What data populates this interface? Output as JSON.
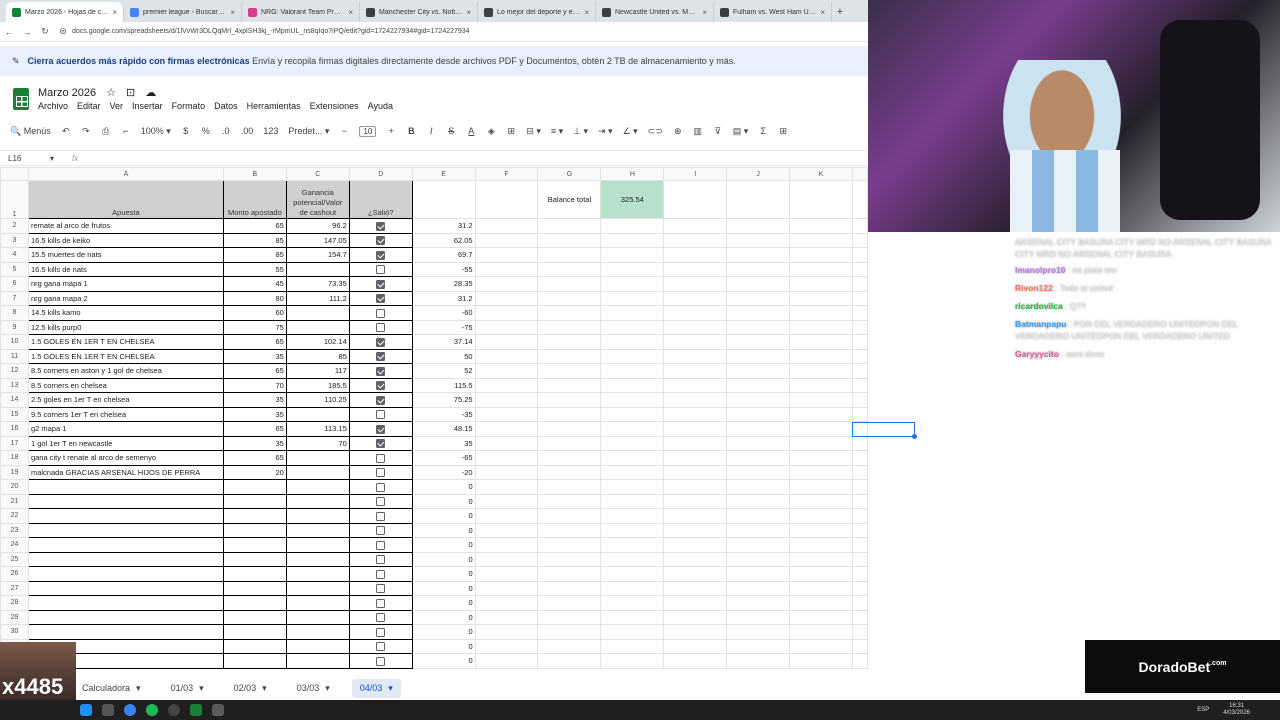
{
  "browser": {
    "tabs": [
      {
        "title": "Marzo 2026 - Hojas de cálculo",
        "color": "#188038",
        "active": true
      },
      {
        "title": "premier league - Buscar con G",
        "color": "#4285f4"
      },
      {
        "title": "NRG: Valorant Team Profile | V",
        "color": "#d93a8b"
      },
      {
        "title": "Manchester City vs. Nottingham",
        "color": "#3c4043"
      },
      {
        "title": "Lo mejor del deporte y el entre",
        "color": "#3c4043"
      },
      {
        "title": "Newcastle United vs. Manchester",
        "color": "#3c4043"
      },
      {
        "title": "Fulham vs. West Ham United | ",
        "color": "#3c4043"
      }
    ],
    "url": "docs.google.com/spreadsheets/d/1lVvWr3DLQqMrl_4xplSH3kj_-rMpmUL_ns8qIqo7iPQ/edit?gid=1724227934#gid=1724227934"
  },
  "banner": {
    "bold": "Cierra acuerdos más rápido con firmas electrónicas",
    "text": "Envía y recopila firmas digitales directamente desde archivos PDF y Documentos, obtén 2 TB de almacenamiento y más."
  },
  "doc": {
    "title": "Marzo 2026"
  },
  "menu": [
    "Archivo",
    "Editar",
    "Ver",
    "Insertar",
    "Formato",
    "Datos",
    "Herramientas",
    "Extensiones",
    "Ayuda"
  ],
  "toolbar": {
    "search": "Menús",
    "zoom": "100%",
    "currency": "$",
    "percent": "%",
    "dec_less": ".0",
    "dec_more": ".00",
    "numfmt": "123",
    "font": "Predet...",
    "fontsize": "10",
    "bold": "B",
    "italic": "I",
    "strike": "S",
    "textcolor": "A"
  },
  "formula": {
    "cellref": "L16",
    "fx": "fx"
  },
  "columns": [
    "A",
    "B",
    "C",
    "D",
    "E",
    "F",
    "G",
    "H",
    "I",
    "J",
    "K"
  ],
  "headers": {
    "a": "Apuesta",
    "b": "Monto apostado",
    "c": "Ganancia potencial/Valor de cashout",
    "d": "¿Salió?",
    "g": "Balance total",
    "h": "325.54"
  },
  "rows": [
    {
      "n": "2",
      "a": "remate al arco de frutos",
      "b": "65",
      "c": "96.2",
      "d": true,
      "e": "31.2"
    },
    {
      "n": "3",
      "a": "16.5 kills de keiko",
      "b": "85",
      "c": "147.05",
      "d": true,
      "e": "62.05"
    },
    {
      "n": "4",
      "a": "15.5 muertes de nats",
      "b": "85",
      "c": "154.7",
      "d": true,
      "e": "69.7"
    },
    {
      "n": "5",
      "a": "16.5 kills de nats",
      "b": "55",
      "c": "",
      "d": false,
      "e": "-55"
    },
    {
      "n": "6",
      "a": "nrg gana mapa 1",
      "b": "45",
      "c": "73.35",
      "d": true,
      "e": "28.35"
    },
    {
      "n": "7",
      "a": "nrg gana mapa 2",
      "b": "80",
      "c": "111.2",
      "d": true,
      "e": "31.2"
    },
    {
      "n": "8",
      "a": "14.5 kills kamo",
      "b": "60",
      "c": "",
      "d": false,
      "e": "-60"
    },
    {
      "n": "9",
      "a": "12.5 kills purp0",
      "b": "75",
      "c": "",
      "d": false,
      "e": "-75"
    },
    {
      "n": "10",
      "a": "1.5 GOLES EN 1ER T EN CHELSEA",
      "b": "65",
      "c": "102.14",
      "d": true,
      "e": "37.14"
    },
    {
      "n": "11",
      "a": "1.5 GOLES EN 1ER T EN CHELSEA",
      "b": "35",
      "c": "85",
      "d": true,
      "e": "50"
    },
    {
      "n": "12",
      "a": "8.5 corners en aston y 1 gol de chelsea",
      "b": "65",
      "c": "117",
      "d": true,
      "e": "52"
    },
    {
      "n": "13",
      "a": "8.5 corners en chelsea",
      "b": "70",
      "c": "185.5",
      "d": true,
      "e": "115.5"
    },
    {
      "n": "14",
      "a": "2.5 goles en 1er T en chelsea",
      "b": "35",
      "c": "110.25",
      "d": true,
      "e": "75.25"
    },
    {
      "n": "15",
      "a": "9.5 corners 1er T en chelsea",
      "b": "35",
      "c": "",
      "d": false,
      "e": "-35"
    },
    {
      "n": "16",
      "a": "g2 mapa 1",
      "b": "65",
      "c": "113.15",
      "d": true,
      "e": "48.15"
    },
    {
      "n": "17",
      "a": "1 gol 1er T en newcastle",
      "b": "35",
      "c": "70",
      "d": true,
      "e": "35"
    },
    {
      "n": "18",
      "a": "gana city t renate al arco de semenyo",
      "b": "65",
      "c": "",
      "d": false,
      "e": "-65"
    },
    {
      "n": "19",
      "a": "malcnada GRACIAS ARSENAL HIJOS DE PERRA",
      "b": "20",
      "c": "",
      "d": false,
      "e": "-20"
    },
    {
      "n": "20",
      "a": "",
      "b": "",
      "c": "",
      "d": false,
      "e": "0"
    },
    {
      "n": "21",
      "a": "",
      "b": "",
      "c": "",
      "d": false,
      "e": "0"
    },
    {
      "n": "22",
      "a": "",
      "b": "",
      "c": "",
      "d": false,
      "e": "0"
    },
    {
      "n": "23",
      "a": "",
      "b": "",
      "c": "",
      "d": false,
      "e": "0"
    },
    {
      "n": "24",
      "a": "",
      "b": "",
      "c": "",
      "d": false,
      "e": "0"
    },
    {
      "n": "25",
      "a": "",
      "b": "",
      "c": "",
      "d": false,
      "e": "0"
    },
    {
      "n": "26",
      "a": "",
      "b": "",
      "c": "",
      "d": false,
      "e": "0"
    },
    {
      "n": "27",
      "a": "",
      "b": "",
      "c": "",
      "d": false,
      "e": "0"
    },
    {
      "n": "28",
      "a": "",
      "b": "",
      "c": "",
      "d": false,
      "e": "0"
    },
    {
      "n": "29",
      "a": "",
      "b": "",
      "c": "",
      "d": false,
      "e": "0"
    },
    {
      "n": "30",
      "a": "",
      "b": "",
      "c": "",
      "d": false,
      "e": "0"
    },
    {
      "n": "31",
      "a": "",
      "b": "",
      "c": "",
      "d": false,
      "e": "0"
    },
    {
      "n": "32",
      "a": "",
      "b": "",
      "c": "",
      "d": false,
      "e": "0"
    }
  ],
  "sheet_tabs": [
    {
      "label": "Calculadora",
      "active": false
    },
    {
      "label": "01/03",
      "active": false
    },
    {
      "label": "02/03",
      "active": false
    },
    {
      "label": "03/03",
      "active": false
    },
    {
      "label": "04/03",
      "active": true
    }
  ],
  "chat": {
    "top": "ARSENAL CITY BASURA CITY MRD NO ARSENAL CITY BASURA CITY MRD NO ARSENAL CITY BASURA",
    "messages": [
      {
        "user": "lmanolpro10",
        "color": "#c37be8",
        "text": "mi plata tmr"
      },
      {
        "user": "Rivon122",
        "color": "#ff7a6b",
        "text": "Todo al united"
      },
      {
        "user": "ricardovilca",
        "color": "#27c23f",
        "text": "Q??"
      },
      {
        "user": "Batmanpapu",
        "color": "#3aa4ff",
        "text": "PON DEL VERDADERO UNITEDPON DEL VERDADERO UNITEDPON DEL VERDADERO UNITED"
      },
      {
        "user": "Garyyycito",
        "color": "#e85d9c",
        "text": "nero done"
      }
    ]
  },
  "overlay": {
    "brand": "DoradoBet",
    "brand_suffix": ".com",
    "counter": "x4485"
  },
  "taskbar": {
    "lang": "ESP",
    "time": "16:31",
    "date": "4/03/2026"
  }
}
